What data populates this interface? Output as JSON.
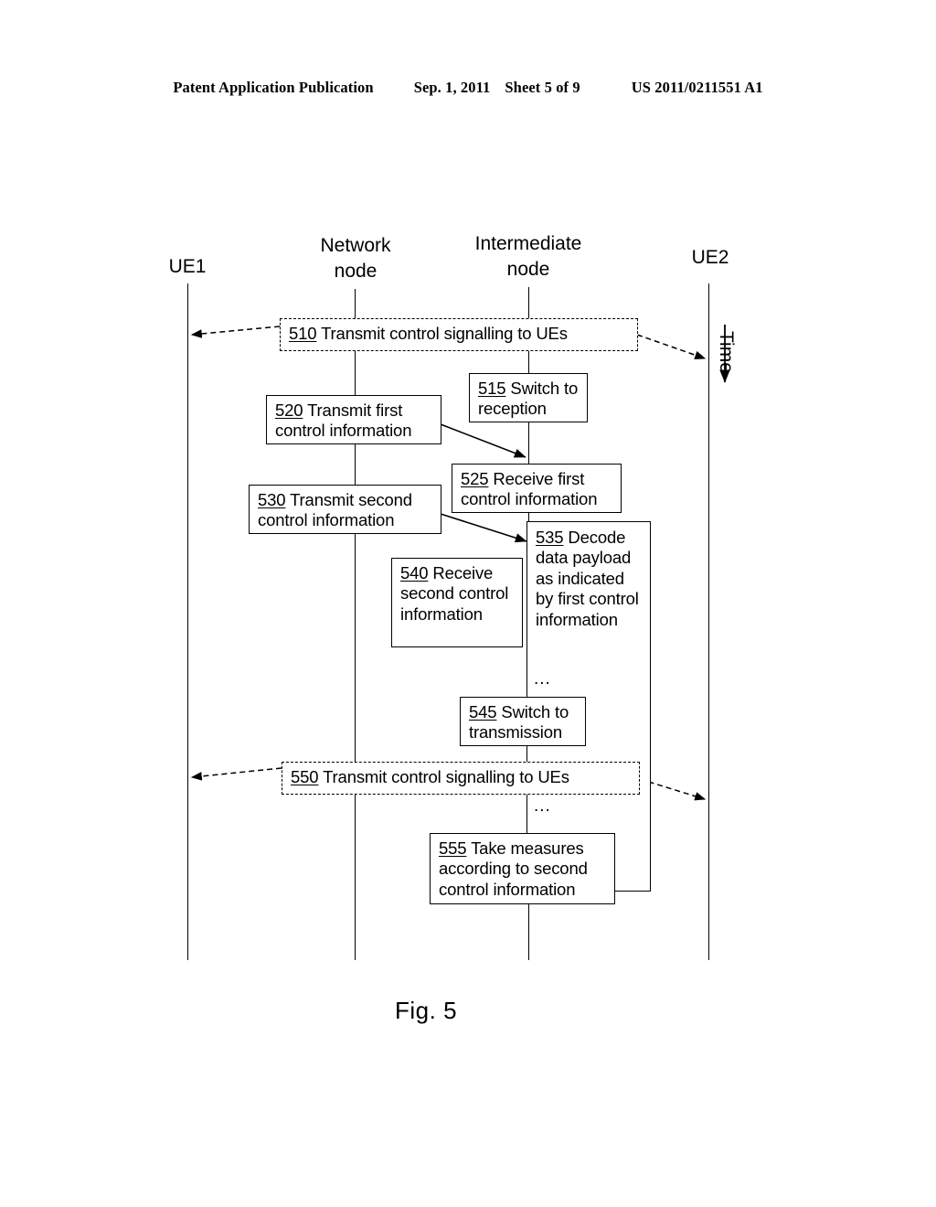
{
  "header": {
    "publication": "Patent Application Publication",
    "date": "Sep. 1, 2011",
    "sheet": "Sheet 5 of 9",
    "number": "US 2011/0211551 A1"
  },
  "figure": {
    "caption": "Fig. 5",
    "time_axis_label": "Time",
    "lifelines": [
      {
        "id": "ue1",
        "label": "UE1"
      },
      {
        "id": "network-node",
        "label": "Network\nnode"
      },
      {
        "id": "intermediate-node",
        "label": "Intermediate\nnode"
      },
      {
        "id": "ue2",
        "label": "UE2"
      }
    ],
    "steps": [
      {
        "id": "510",
        "ref": "510",
        "text": "  Transmit control signalling to UEs",
        "style": "dashed"
      },
      {
        "id": "515",
        "ref": "515",
        "text": " Switch to reception",
        "style": "solid"
      },
      {
        "id": "520",
        "ref": "520",
        "text": " Transmit first control information",
        "style": "solid"
      },
      {
        "id": "525",
        "ref": "525",
        "text": " Receive first control information",
        "style": "solid"
      },
      {
        "id": "530",
        "ref": "530",
        "text": " Transmit second control information",
        "style": "solid"
      },
      {
        "id": "535",
        "ref": "535",
        "text": " Decode data payload as indicated by first control information",
        "style": "solid"
      },
      {
        "id": "540",
        "ref": "540",
        "text": "  Receive second control information",
        "style": "solid"
      },
      {
        "id": "545",
        "ref": "545",
        "text": " Switch to transmission",
        "style": "solid"
      },
      {
        "id": "550",
        "ref": "550",
        "text": " Transmit control signalling to UEs",
        "style": "dashed"
      },
      {
        "id": "555",
        "ref": "555",
        "text": " Take measures according to second control information",
        "style": "solid"
      }
    ],
    "ellipses": [
      {
        "id": "ellipsis-535",
        "text": "..."
      },
      {
        "id": "ellipsis-550",
        "text": "..."
      }
    ]
  }
}
